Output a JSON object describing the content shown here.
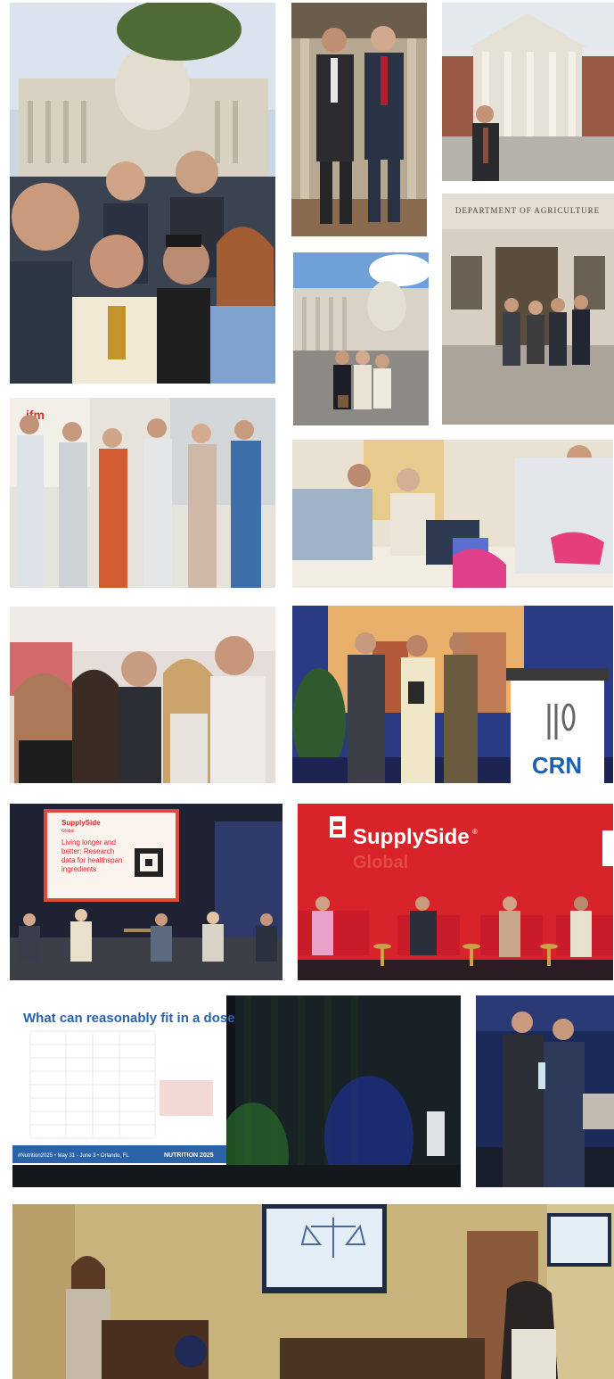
{
  "collage": {
    "photos": [
      {
        "id": "capitol-selfie"
      },
      {
        "id": "two-men-suits"
      },
      {
        "id": "man-state-building"
      },
      {
        "id": "capitol-steps-group"
      },
      {
        "id": "department-of-agriculture-group"
      },
      {
        "id": "ifm-office-group"
      },
      {
        "id": "volunteers-packing"
      },
      {
        "id": "reception-selfie"
      },
      {
        "id": "crn-award-stage"
      },
      {
        "id": "supplyside-panel-screen"
      },
      {
        "id": "supplyside-red-stage"
      },
      {
        "id": "nutrition-2025-presentation"
      },
      {
        "id": "award-handshake"
      },
      {
        "id": "hearing-room-speaker"
      }
    ]
  },
  "signs": {
    "department": "DEPARTMENT OF AGRICULTURE",
    "ifm": "ifm",
    "crn": "CRN"
  },
  "panel_slide": {
    "brand": "SupplySide",
    "brand_sub": "Global",
    "title_1": "Living longer and",
    "title_2": "better: Research",
    "title_3": "data for healthspan",
    "title_4": "ingredients"
  },
  "stage_banner": {
    "brand": "SupplySide",
    "reg": "®",
    "sub": "Global"
  },
  "nutrition_slide": {
    "title": "What can reasonably fit in a dose",
    "footer": "#Nutrition2025 • May 31 - June 3 • Orlando, FL",
    "logo": "NUTRITION 2025"
  },
  "colors": {
    "crn_blue": "#1d5fb0",
    "supplyside_red": "#d8232a",
    "slide_blue": "#2b63a8"
  }
}
